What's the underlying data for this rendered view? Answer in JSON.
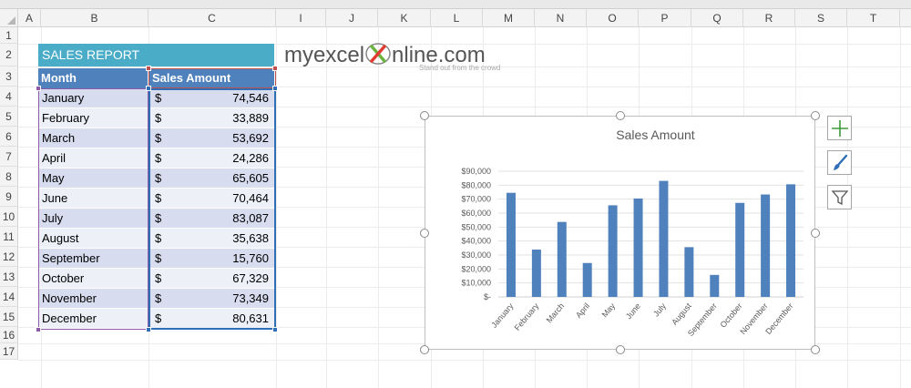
{
  "columns": [
    "A",
    "B",
    "C",
    "I",
    "J",
    "K",
    "L",
    "M",
    "N",
    "O",
    "P",
    "Q",
    "R",
    "S",
    "T"
  ],
  "rows": [
    "1",
    "2",
    "3",
    "4",
    "5",
    "6",
    "7",
    "8",
    "9",
    "10",
    "11",
    "12",
    "13",
    "14",
    "15",
    "16",
    "17"
  ],
  "report": {
    "title": "SALES REPORT",
    "month_header": "Month",
    "amount_header": "Sales Amount",
    "currency_symbol": "$",
    "rows": [
      {
        "month": "January",
        "amount": "74,546"
      },
      {
        "month": "February",
        "amount": "33,889"
      },
      {
        "month": "March",
        "amount": "53,692"
      },
      {
        "month": "April",
        "amount": "24,286"
      },
      {
        "month": "May",
        "amount": "65,605"
      },
      {
        "month": "June",
        "amount": "70,464"
      },
      {
        "month": "July",
        "amount": "83,087"
      },
      {
        "month": "August",
        "amount": "35,638"
      },
      {
        "month": "September",
        "amount": "15,760"
      },
      {
        "month": "October",
        "amount": "67,329"
      },
      {
        "month": "November",
        "amount": "73,349"
      },
      {
        "month": "December",
        "amount": "80,631"
      }
    ]
  },
  "logo": {
    "text_left": "myexcel",
    "text_right": "nline.com",
    "tagline": "Stand out from the crowd"
  },
  "side_buttons": [
    "chart-elements-icon",
    "chart-styles-icon",
    "chart-filters-icon"
  ],
  "colors": {
    "title_bg": "#4aacc6",
    "header_bg": "#4f81bd",
    "bar": "#4f81bd",
    "logo_x_green": "#6cb33f",
    "logo_x_red": "#e03c31"
  },
  "chart_data": {
    "type": "bar",
    "title": "Sales Amount",
    "categories": [
      "January",
      "February",
      "March",
      "April",
      "May",
      "June",
      "July",
      "August",
      "September",
      "October",
      "November",
      "December"
    ],
    "values": [
      74546,
      33889,
      53692,
      24286,
      65605,
      70464,
      83087,
      35638,
      15760,
      67329,
      73349,
      80631
    ],
    "ylim": [
      0,
      90000
    ],
    "yticks": [
      0,
      10000,
      20000,
      30000,
      40000,
      50000,
      60000,
      70000,
      80000,
      90000
    ],
    "ytick_labels": [
      "$-",
      "$10,000",
      "$20,000",
      "$30,000",
      "$40,000",
      "$50,000",
      "$60,000",
      "$70,000",
      "$80,000",
      "$90,000"
    ],
    "grid": true,
    "legend": "none",
    "xlabel": "",
    "ylabel": ""
  }
}
